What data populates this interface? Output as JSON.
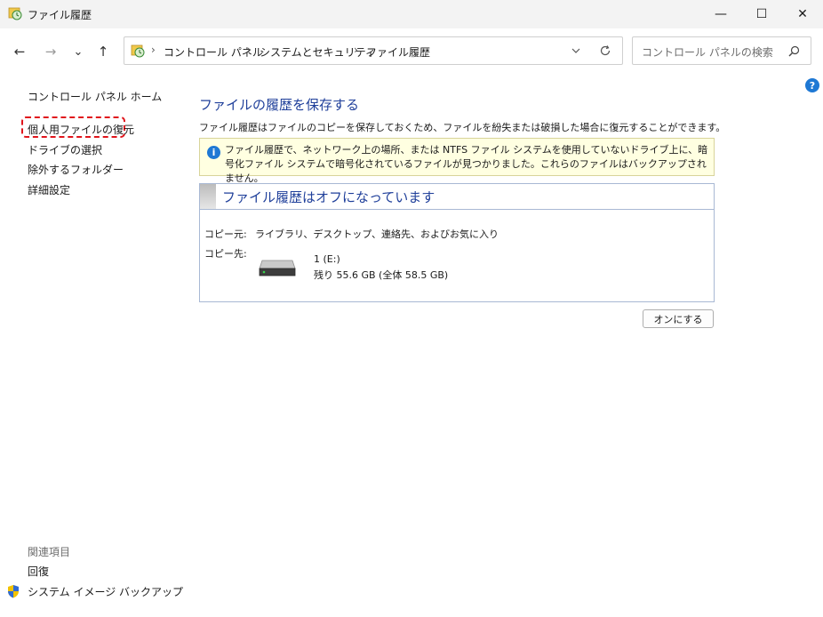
{
  "window": {
    "title": "ファイル履歴",
    "minimize": "—",
    "maximize": "☐",
    "close": "✕"
  },
  "nav": {
    "back": "←",
    "forward": "→",
    "recent": "⌄",
    "up": "↑"
  },
  "address": {
    "crumbs": [
      "コントロール パネル",
      "システムとセキュリティ",
      "ファイル履歴"
    ],
    "separator": "›"
  },
  "search": {
    "placeholder": "コントロール パネルの検索"
  },
  "sidebar": {
    "home": "コントロール パネル ホーム",
    "items": [
      "個人用ファイルの復元",
      "ドライブの選択",
      "除外するフォルダー",
      "詳細設定"
    ],
    "related_title": "関連項目",
    "related": [
      "回復",
      "システム イメージ バックアップ"
    ]
  },
  "main": {
    "title": "ファイルの履歴を保存する",
    "description": "ファイル履歴はファイルのコピーを保存しておくため、ファイルを紛失または破損した場合に復元することができます。",
    "warning": "ファイル履歴で、ネットワーク上の場所、または NTFS ファイル システムを使用していないドライブ上に、暗号化ファイル システムで暗号化されているファイルが見つかりました。これらのファイルはバックアップされません。",
    "status_title": "ファイル履歴はオフになっています",
    "copy_from_label": "コピー元:",
    "copy_from_value": "ライブラリ、デスクトップ、連絡先、およびお気に入り",
    "copy_to_label": "コピー先:",
    "drive_name": "1 (E:)",
    "drive_space": "残り 55.6 GB (全体 58.5 GB)",
    "turn_on": "オンにする"
  },
  "colors": {
    "accent": "#1f3f9a",
    "highlight": "#e0141b",
    "warning_bg": "#ffffe1"
  }
}
